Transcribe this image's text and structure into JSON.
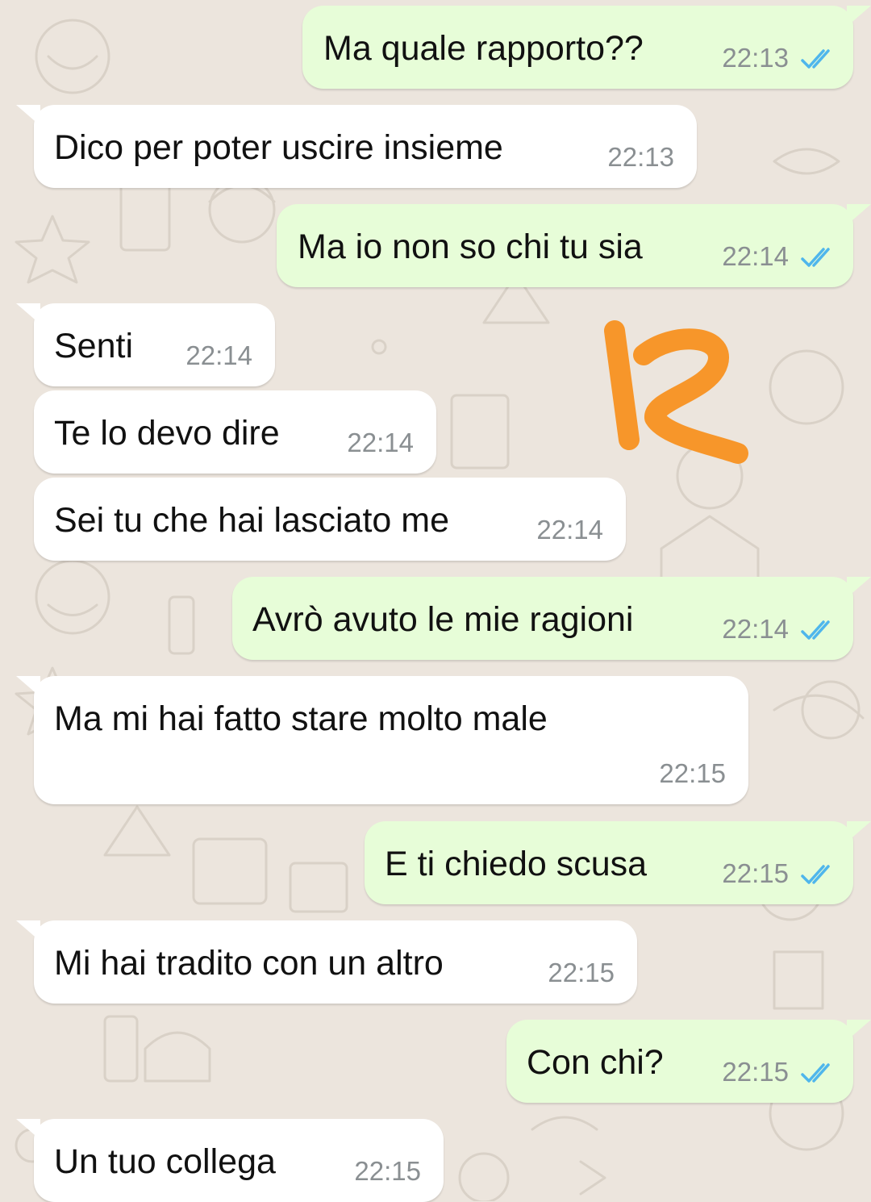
{
  "chat": {
    "messages": [
      {
        "dir": "out",
        "text": "Ma quale rapporto??",
        "time": "22:13",
        "status": "read"
      },
      {
        "dir": "in",
        "text": "Dico per poter uscire insieme",
        "time": "22:13"
      },
      {
        "dir": "out",
        "text": "Ma io non so chi tu sia",
        "time": "22:14",
        "status": "read"
      },
      {
        "dir": "in",
        "text": "Senti",
        "time": "22:14"
      },
      {
        "dir": "in",
        "text": "Te lo devo dire",
        "time": "22:14"
      },
      {
        "dir": "in",
        "text": "Sei tu che hai lasciato me",
        "time": "22:14"
      },
      {
        "dir": "out",
        "text": "Avrò avuto le mie ragioni",
        "time": "22:14",
        "status": "read"
      },
      {
        "dir": "in",
        "text": "Ma mi hai fatto stare molto male",
        "time": "22:15"
      },
      {
        "dir": "out",
        "text": "E ti chiedo scusa",
        "time": "22:15",
        "status": "read"
      },
      {
        "dir": "in",
        "text": "Mi hai tradito con un altro",
        "time": "22:15"
      },
      {
        "dir": "out",
        "text": "Con chi?",
        "time": "22:15",
        "status": "read"
      },
      {
        "dir": "in",
        "text": "Un tuo collega",
        "time": "22:15"
      }
    ]
  },
  "annotation": {
    "text": "12",
    "color": "#f7962a"
  },
  "colors": {
    "wallpaper": "#ece5dd",
    "incoming_bubble": "#ffffff",
    "outgoing_bubble": "#e7fdd8",
    "read_ticks": "#4fb6ec",
    "timestamp": "#8a8f92"
  },
  "icons": {
    "read_status": "double-check-icon",
    "tail": "bubble-tail-icon"
  }
}
